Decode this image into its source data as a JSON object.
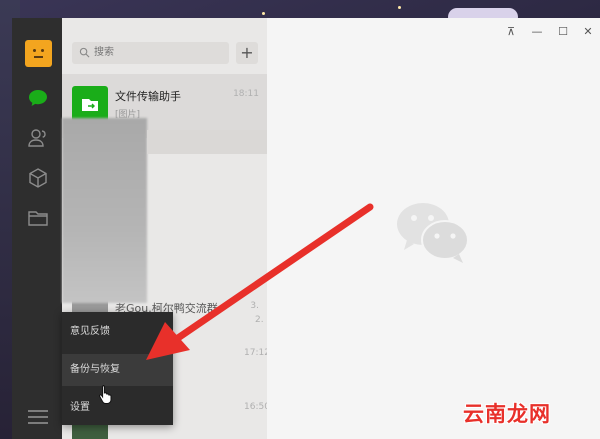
{
  "search": {
    "placeholder": "搜索"
  },
  "toolbar": {
    "add_label": "+"
  },
  "chats": [
    {
      "name": "文件传输助手",
      "preview": "[图片]",
      "time": "18:11"
    },
    {
      "name": "老Gou.柯尔鸭交流群",
      "preview": "",
      "time": "3."
    }
  ],
  "list_times": [
    "2.",
    "17:12",
    "16:50"
  ],
  "menu": {
    "items": [
      "意见反馈",
      "备份与恢复",
      "设置"
    ]
  },
  "window": {
    "controls": [
      "⊼",
      "—",
      "☐",
      "✕"
    ]
  },
  "watermark": "云南龙网",
  "colors": {
    "accent": "#1aad19",
    "arrow": "#e8302a",
    "sidebar": "#2e2e2e"
  },
  "icons": [
    "chat-icon",
    "contacts-icon",
    "cube-icon",
    "folder-icon",
    "menu-icon",
    "search-icon",
    "wechat-logo-icon"
  ]
}
